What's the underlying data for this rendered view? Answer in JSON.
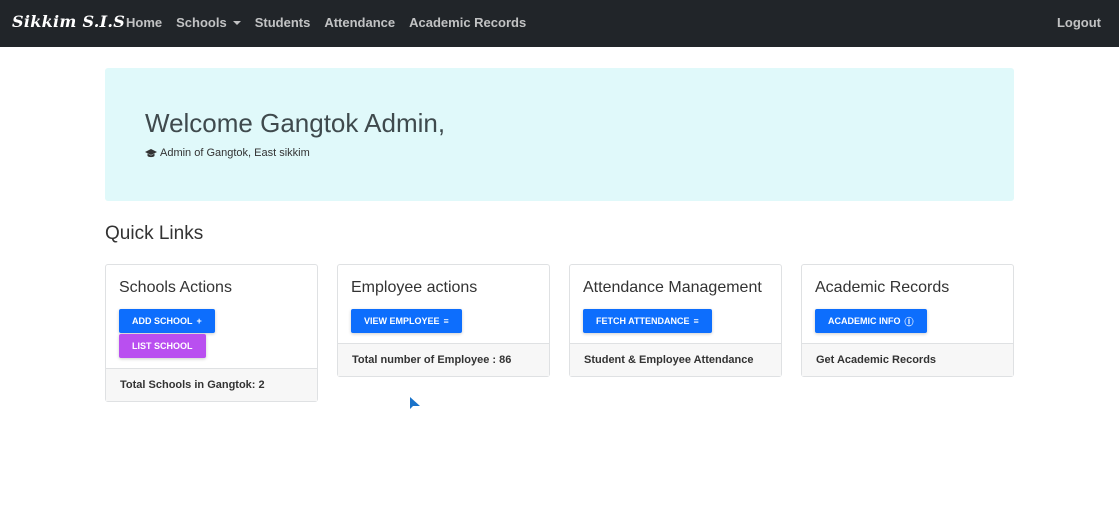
{
  "navbar": {
    "brand": "Sikkim S.I.S",
    "links": [
      "Home",
      "Schools",
      "Students",
      "Attendance",
      "Academic Records"
    ],
    "logout": "Logout"
  },
  "welcome": {
    "title": "Welcome Gangtok Admin,",
    "subtitle": "Admin of Gangtok, East sikkim",
    "icon": "graduation-cap-icon"
  },
  "quick_links": {
    "title": "Quick Links",
    "cards": [
      {
        "title": "Schools Actions",
        "buttons": [
          {
            "label": "ADD SCHOOL",
            "icon": "+",
            "color": "#0d6efd"
          },
          {
            "label": "LIST SCHOOL",
            "color": "#b94ff0"
          }
        ],
        "footer": "Total Schools in Gangtok: 2"
      },
      {
        "title": "Employee actions",
        "buttons": [
          {
            "label": "VIEW EMPLOYEE",
            "icon": "list-icon",
            "color": "#0d6efd"
          }
        ],
        "footer": "Total number of Employee : 86"
      },
      {
        "title": "Attendance Management",
        "buttons": [
          {
            "label": "FETCH ATTENDANCE",
            "icon": "list-icon",
            "color": "#0d6efd"
          }
        ],
        "footer": "Student & Employee Attendance"
      },
      {
        "title": "Academic Records",
        "buttons": [
          {
            "label": "ACADEMIC INFO",
            "icon": "info-circle-icon",
            "color": "#0d6efd"
          }
        ],
        "footer": "Get Academic Records"
      }
    ]
  }
}
